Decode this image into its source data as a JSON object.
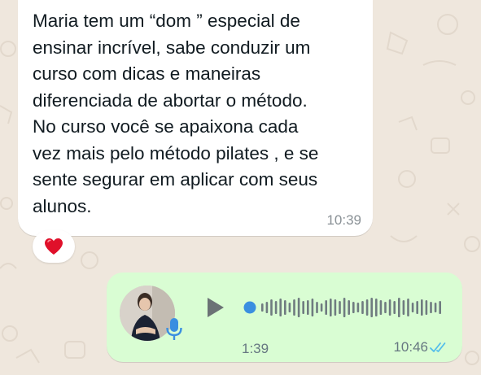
{
  "incoming_message": {
    "text": "Maria tem um “dom ” especial de\nensinar incrível, sabe conduzir um\ncurso com dicas e maneiras\ndiferenciada de abortar o método.\nNo curso você se apaixona cada\nvez mais pelo método pilates , e se\nsente segurar em aplicar com seus\nalunos.",
    "time": "10:39",
    "reaction": "❤️"
  },
  "outgoing_voice_message": {
    "duration": "1:39",
    "time": "10:46",
    "playback_progress": 0,
    "status": "read",
    "status_color": "#53bdeb"
  },
  "colors": {
    "wallpaper": "#efe7dd",
    "incoming_bubble": "#ffffff",
    "outgoing_bubble": "#d9fdd3",
    "voice_accent": "#3a8fe0",
    "waveform": "#6f7b80"
  },
  "icons": [
    "heart-icon",
    "play-icon",
    "microphone-icon",
    "double-check-icon"
  ]
}
